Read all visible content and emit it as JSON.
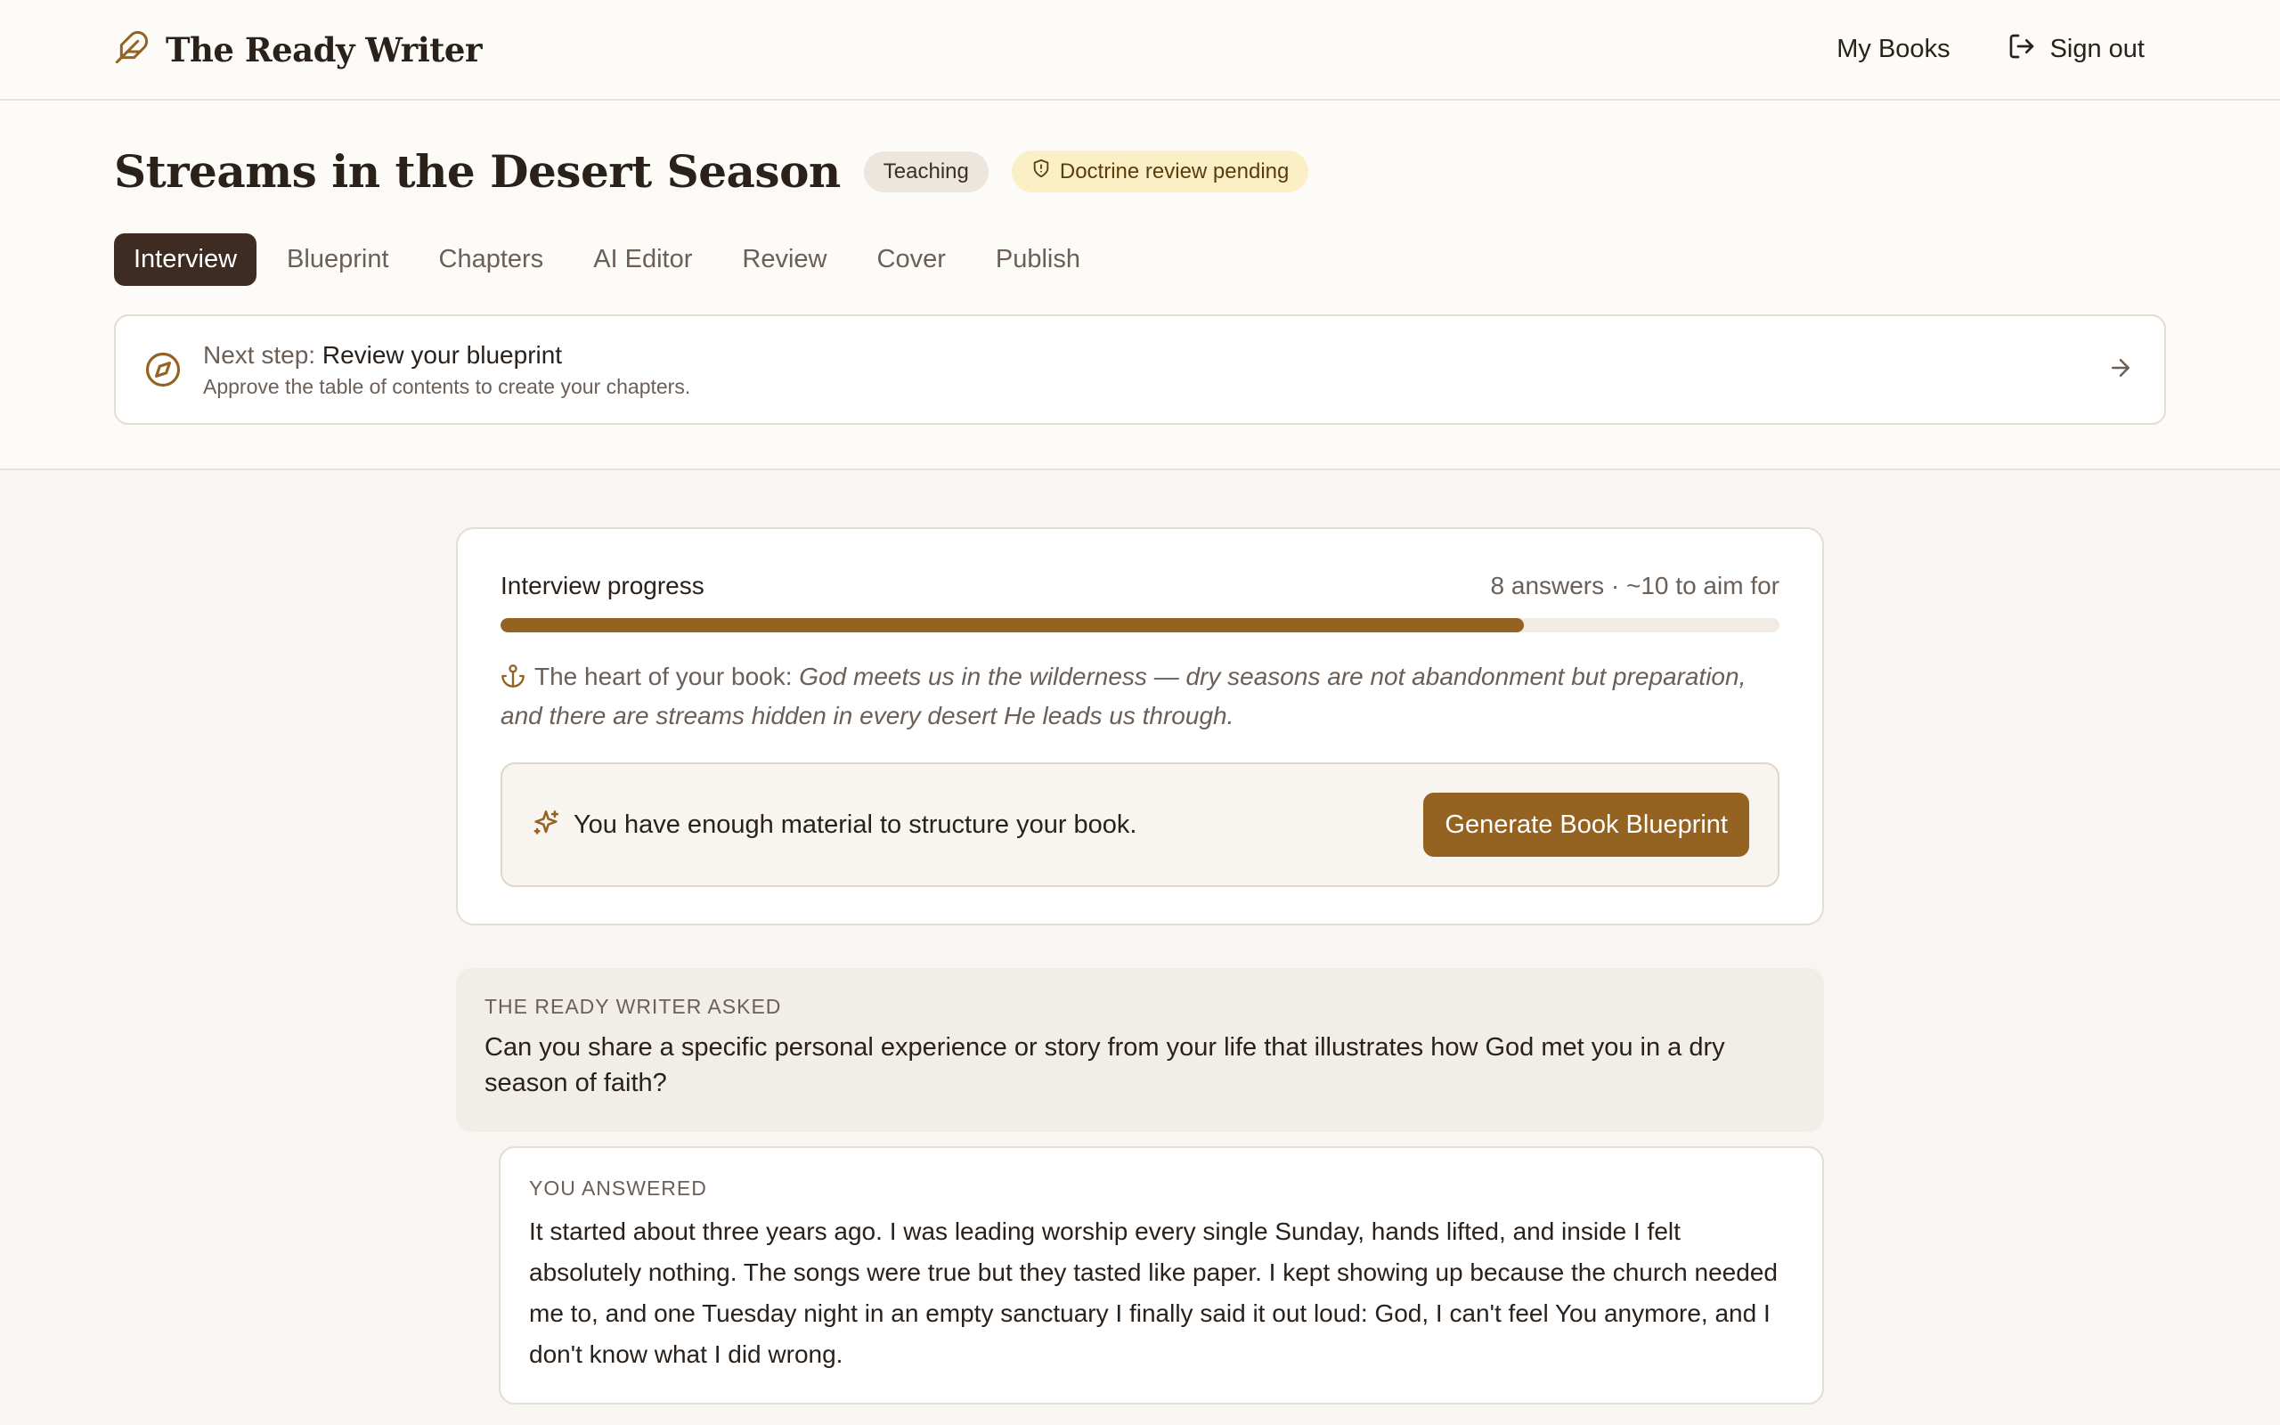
{
  "app": {
    "name": "The Ready Writer",
    "icon": "feather-icon"
  },
  "topnav": {
    "my_books": "My Books",
    "sign_out": "Sign out"
  },
  "book": {
    "title": "Streams in the Desert Season",
    "genre_badge": "Teaching",
    "review_badge": "Doctrine review pending"
  },
  "tabs": [
    {
      "label": "Interview",
      "active": true
    },
    {
      "label": "Blueprint"
    },
    {
      "label": "Chapters"
    },
    {
      "label": "AI Editor"
    },
    {
      "label": "Review"
    },
    {
      "label": "Cover"
    },
    {
      "label": "Publish"
    }
  ],
  "next_step": {
    "prefix": "Next step:",
    "title": "Review your blueprint",
    "subtitle": "Approve the table of contents to create your chapters."
  },
  "progress": {
    "title": "Interview progress",
    "count_text": "8 answers · ~10 to aim for",
    "answers": 8,
    "target": 10,
    "heart_label": "The heart of your book:",
    "heart_text": "God meets us in the wilderness — dry seasons are not abandonment but preparation, and there are streams hidden in every desert He leads us through.",
    "ready_text": "You have enough material to structure your book.",
    "generate_button": "Generate Book Blueprint"
  },
  "conversation": {
    "asked_label": "The Ready Writer asked",
    "question": "Can you share a specific personal experience or story from your life that illustrates how God met you in a dry season of faith?",
    "answer_label": "You answered",
    "answer": "It started about three years ago. I was leading worship every single Sunday, hands lifted, and inside I felt absolutely nothing. The songs were true but they tasted like paper. I kept showing up because the church needed me to, and one Tuesday night in an empty sanctuary I finally said it out loud: God, I can't feel You anymore, and I don't know what I did wrong."
  },
  "colors": {
    "accent": "#946322",
    "active_tab": "#3e2b22",
    "pending_badge_bg": "#fbefc6"
  }
}
